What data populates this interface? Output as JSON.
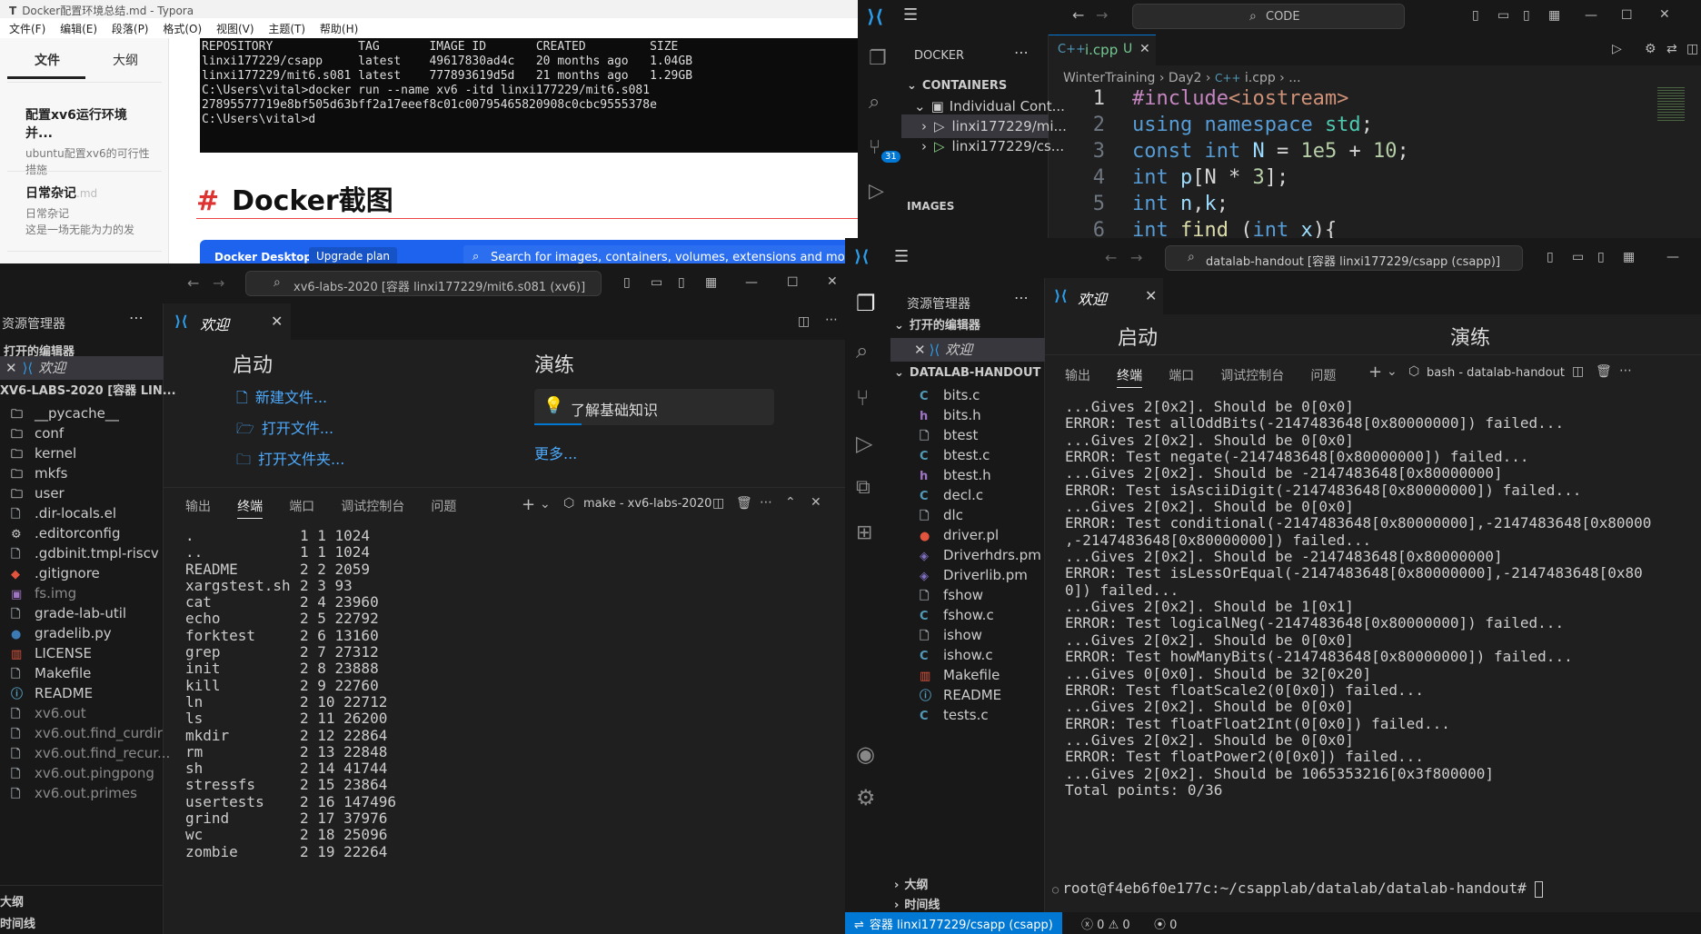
{
  "typora": {
    "title": "Docker配置环境总结.md - Typora",
    "menu": [
      "文件(F)",
      "编辑(E)",
      "段落(P)",
      "格式(O)",
      "视图(V)",
      "主题(T)",
      "帮助(H)"
    ],
    "tabs": {
      "files": "文件",
      "outline": "大纲"
    },
    "docs": [
      {
        "title": "配置xv6运行环境并...",
        "subtitle": "ubuntu配置xv6的可行性措施"
      },
      {
        "title": "日常杂记",
        "ext": ".md",
        "subtitle": "日常杂记\n这是一场无能为力的发"
      }
    ],
    "terminal_lines": [
      "REPOSITORY            TAG       IMAGE ID       CREATED         SIZE",
      "linxi177229/csapp     latest    49617830ad4c   20 months ago   1.04GB",
      "linxi177229/mit6.s081 latest    777893619d5d   21 months ago   1.29GB",
      "",
      "C:\\Users\\vital>docker run --name xv6 -itd linxi177229/mit6.s081",
      "27895577719e8bf505d63bff2a17eeef8c01c00795465820908c0cbc9555378e",
      "",
      "C:\\Users\\vital>d"
    ],
    "heading_hash": "#",
    "heading": "Docker截图",
    "docker_desktop": {
      "brand": "Docker Desktop",
      "upgrade": "Upgrade plan",
      "search": "Search for images, containers, volumes, extensions and more"
    }
  },
  "w1": {
    "search": "CODE",
    "sidebar_title": "DOCKER",
    "containers_label": "CONTAINERS",
    "group_label": "Individual Cont...",
    "containers": [
      "linxi177229/mi...",
      "linxi177229/cs..."
    ],
    "images_label": "IMAGES",
    "scm_badge": "31",
    "tab": {
      "name": "i.cpp",
      "status": "U"
    },
    "breadcrumb": [
      "WinterTraining",
      "Day2",
      "i.cpp",
      "..."
    ],
    "code_lines": [
      {
        "n": "1",
        "parts": [
          [
            "kw2",
            "#include"
          ],
          [
            "inc",
            "<iostream>"
          ]
        ]
      },
      {
        "n": "2",
        "parts": [
          [
            "kw",
            "using "
          ],
          [
            "kw",
            "namespace "
          ],
          [
            "ty",
            "std"
          ],
          [
            "op",
            ";"
          ]
        ]
      },
      {
        "n": "3",
        "parts": [
          [
            "kw",
            "const "
          ],
          [
            "kw",
            "int "
          ],
          [
            "id",
            "N"
          ],
          [
            "op",
            " = "
          ],
          [
            "num",
            "1e5"
          ],
          [
            "op",
            " + "
          ],
          [
            "num",
            "10"
          ],
          [
            "op",
            ";"
          ]
        ]
      },
      {
        "n": "4",
        "parts": [
          [
            "kw",
            "int "
          ],
          [
            "id",
            "p"
          ],
          [
            "op",
            "[N * "
          ],
          [
            "num",
            "3"
          ],
          [
            "op",
            "];"
          ]
        ]
      },
      {
        "n": "5",
        "parts": [
          [
            "kw",
            "int "
          ],
          [
            "id",
            "n"
          ],
          [
            "op",
            ","
          ],
          [
            "id",
            "k"
          ],
          [
            "op",
            ";"
          ]
        ]
      },
      {
        "n": "6",
        "parts": [
          [
            "kw",
            "int "
          ],
          [
            "fn",
            "find "
          ],
          [
            "op",
            "("
          ],
          [
            "kw",
            "int "
          ],
          [
            "id",
            "x"
          ],
          [
            "op",
            "){"
          ]
        ]
      }
    ]
  },
  "w2": {
    "search": "xv6-labs-2020 [容器 linxi177229/mit6.s081 (xv6)]",
    "explorer_title": "资源管理器",
    "open_editors": "打开的编辑器",
    "open_file": "欢迎",
    "root_folder": "XV6-LABS-2020 [容器 LIN...",
    "files": [
      {
        "name": "__pycache__",
        "kind": "folder"
      },
      {
        "name": "conf",
        "kind": "folder"
      },
      {
        "name": "kernel",
        "kind": "folder"
      },
      {
        "name": "mkfs",
        "kind": "folder"
      },
      {
        "name": "user",
        "kind": "folder"
      },
      {
        "name": ".dir-locals.el",
        "kind": "file"
      },
      {
        "name": ".editorconfig",
        "kind": "gear"
      },
      {
        "name": ".gdbinit.tmpl-riscv",
        "kind": "file"
      },
      {
        "name": ".gitignore",
        "kind": "git"
      },
      {
        "name": "fs.img",
        "kind": "img"
      },
      {
        "name": "grade-lab-util",
        "kind": "file"
      },
      {
        "name": "gradelib.py",
        "kind": "py"
      },
      {
        "name": "LICENSE",
        "kind": "license"
      },
      {
        "name": "Makefile",
        "kind": "file"
      },
      {
        "name": "README",
        "kind": "info"
      },
      {
        "name": "xv6.out",
        "kind": "file"
      },
      {
        "name": "xv6.out.find_curdir",
        "kind": "file"
      },
      {
        "name": "xv6.out.find_recur...",
        "kind": "file"
      },
      {
        "name": "xv6.out.pingpong",
        "kind": "file"
      },
      {
        "name": "xv6.out.primes",
        "kind": "file"
      }
    ],
    "outline": "大纲",
    "timeline": "时间线",
    "tab": "欢迎",
    "start_heading": "启动",
    "start_links": [
      "新建文件...",
      "打开文件...",
      "打开文件夹..."
    ],
    "walk_heading": "演练",
    "walk_item": "了解基础知识",
    "more": "更多...",
    "panel_tabs": [
      "输出",
      "终端",
      "端口",
      "调试控制台",
      "问题"
    ],
    "terminal_name": "make - xv6-labs-2020",
    "ls_rows": [
      [
        ".",
        "1 1 1024"
      ],
      [
        "..",
        "1 1 1024"
      ],
      [
        "README",
        "2 2 2059"
      ],
      [
        "xargstest.sh",
        "2 3 93"
      ],
      [
        "cat",
        "2 4 23960"
      ],
      [
        "echo",
        "2 5 22792"
      ],
      [
        "forktest",
        "2 6 13160"
      ],
      [
        "grep",
        "2 7 27312"
      ],
      [
        "init",
        "2 8 23888"
      ],
      [
        "kill",
        "2 9 22760"
      ],
      [
        "ln",
        "2 10 22712"
      ],
      [
        "ls",
        "2 11 26200"
      ],
      [
        "mkdir",
        "2 12 22864"
      ],
      [
        "rm",
        "2 13 22848"
      ],
      [
        "sh",
        "2 14 41744"
      ],
      [
        "stressfs",
        "2 15 23864"
      ],
      [
        "usertests",
        "2 16 147496"
      ],
      [
        "grind",
        "2 17 37976"
      ],
      [
        "wc",
        "2 18 25096"
      ],
      [
        "zombie",
        "2 19 22264"
      ]
    ]
  },
  "w3": {
    "search": "datalab-handout [容器 linxi177229/csapp (csapp)]",
    "explorer_title": "资源管理器",
    "open_editors": "打开的编辑器",
    "open_file": "欢迎",
    "root_folder": "DATALAB-HANDOUT [容器...",
    "files": [
      {
        "name": "bits.c",
        "kind": "c"
      },
      {
        "name": "bits.h",
        "kind": "h"
      },
      {
        "name": "btest",
        "kind": "file"
      },
      {
        "name": "btest.c",
        "kind": "c"
      },
      {
        "name": "btest.h",
        "kind": "h"
      },
      {
        "name": "decl.c",
        "kind": "c"
      },
      {
        "name": "dlc",
        "kind": "file"
      },
      {
        "name": "driver.pl",
        "kind": "perl"
      },
      {
        "name": "Driverhdrs.pm",
        "kind": "pm"
      },
      {
        "name": "Driverlib.pm",
        "kind": "pm"
      },
      {
        "name": "fshow",
        "kind": "file"
      },
      {
        "name": "fshow.c",
        "kind": "c"
      },
      {
        "name": "ishow",
        "kind": "file"
      },
      {
        "name": "ishow.c",
        "kind": "c"
      },
      {
        "name": "Makefile",
        "kind": "make"
      },
      {
        "name": "README",
        "kind": "info"
      },
      {
        "name": "tests.c",
        "kind": "c"
      }
    ],
    "outline": "大纲",
    "timeline": "时间线",
    "tab": "欢迎",
    "start_heading": "启动",
    "walk_heading": "演练",
    "panel_tabs": [
      "输出",
      "终端",
      "端口",
      "调试控制台",
      "问题"
    ],
    "terminal_name": "bash - datalab-handout",
    "terminal_lines": [
      "...Gives 2[0x2]. Should be 0[0x0]",
      "ERROR: Test allOddBits(-2147483648[0x80000000]) failed...",
      "...Gives 2[0x2]. Should be 0[0x0]",
      "ERROR: Test negate(-2147483648[0x80000000]) failed...",
      "...Gives 2[0x2]. Should be -2147483648[0x80000000]",
      "ERROR: Test isAsciiDigit(-2147483648[0x80000000]) failed...",
      "...Gives 2[0x2]. Should be 0[0x0]",
      "ERROR: Test conditional(-2147483648[0x80000000],-2147483648[0x80000",
      ",-2147483648[0x80000000]) failed...",
      "...Gives 2[0x2]. Should be -2147483648[0x80000000]",
      "ERROR: Test isLessOrEqual(-2147483648[0x80000000],-2147483648[0x80",
      "0]) failed...",
      "...Gives 2[0x2]. Should be 1[0x1]",
      "ERROR: Test logicalNeg(-2147483648[0x80000000]) failed...",
      "...Gives 2[0x2]. Should be 0[0x0]",
      "ERROR: Test howManyBits(-2147483648[0x80000000]) failed...",
      "...Gives 0[0x0]. Should be 32[0x20]",
      "ERROR: Test floatScale2(0[0x0]) failed...",
      "...Gives 2[0x2]. Should be 0[0x0]",
      "ERROR: Test floatFloat2Int(0[0x0]) failed...",
      "...Gives 2[0x2]. Should be 0[0x0]",
      "ERROR: Test floatPower2(0[0x0]) failed...",
      "...Gives 2[0x2]. Should be 1065353216[0x3f800000]",
      "Total points: 0/36"
    ],
    "prompt": "root@f4eb6f0e177c:~/csapplab/datalab/datalab-handout# ",
    "status": {
      "remote": "容器 linxi177229/csapp (csapp)",
      "errors": "0",
      "warnings": "0",
      "ports": "0"
    }
  },
  "colors": {
    "vsc_bg": "#1f1f1f",
    "vsc_side": "#181818",
    "accent": "#0078d4",
    "typora_heading_hash": "#dd3333",
    "docker_blue": "#1d63ed"
  }
}
